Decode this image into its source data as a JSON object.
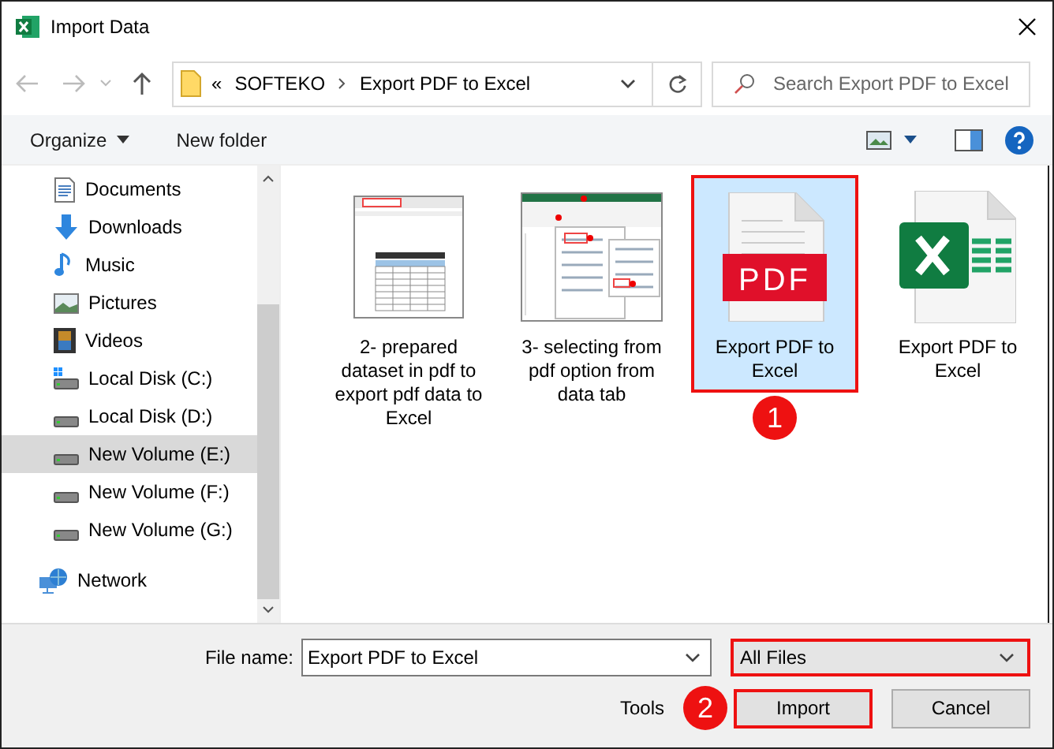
{
  "window": {
    "title": "Import Data"
  },
  "address": {
    "path": [
      {
        "label": "SOFTEKO"
      },
      {
        "label": "Export PDF to Excel"
      }
    ],
    "overflow": "«"
  },
  "search": {
    "placeholder": "Search Export PDF to Excel"
  },
  "toolbar": {
    "organize": "Organize",
    "new_folder": "New folder"
  },
  "sidebar": {
    "items": [
      {
        "label": "Documents",
        "kind": "documents",
        "selected": false
      },
      {
        "label": "Downloads",
        "kind": "downloads",
        "selected": false
      },
      {
        "label": "Music",
        "kind": "music",
        "selected": false
      },
      {
        "label": "Pictures",
        "kind": "pictures",
        "selected": false
      },
      {
        "label": "Videos",
        "kind": "videos",
        "selected": false
      },
      {
        "label": "Local Disk (C:)",
        "kind": "system-disk",
        "selected": false
      },
      {
        "label": "Local Disk (D:)",
        "kind": "disk",
        "selected": false
      },
      {
        "label": "New Volume (E:)",
        "kind": "disk",
        "selected": true
      },
      {
        "label": "New Volume (F:)",
        "kind": "disk",
        "selected": false
      },
      {
        "label": "New Volume (G:)",
        "kind": "disk",
        "selected": false
      },
      {
        "label": "Network",
        "kind": "network",
        "selected": false
      }
    ]
  },
  "files": [
    {
      "label": "2- prepared dataset in pdf to export pdf data to Excel",
      "kind": "table-screenshot",
      "selected": false,
      "outlined": false
    },
    {
      "label": "3- selecting from pdf option from data tab",
      "kind": "ribbon-screenshot",
      "selected": false,
      "outlined": false
    },
    {
      "label": "Export PDF to Excel",
      "kind": "pdf",
      "badge": "PDF",
      "selected": true,
      "outlined": true,
      "marker": "1"
    },
    {
      "label": "Export PDF to Excel",
      "kind": "excel",
      "selected": false,
      "outlined": false
    }
  ],
  "file_name": {
    "label": "File name:",
    "value": "Export PDF to Excel"
  },
  "file_type": {
    "value": "All Files",
    "outlined": true
  },
  "tools": "Tools",
  "buttons": [
    {
      "label": "Import",
      "outlined": true,
      "marker": "2"
    },
    {
      "label": "Cancel",
      "outlined": false
    }
  ]
}
